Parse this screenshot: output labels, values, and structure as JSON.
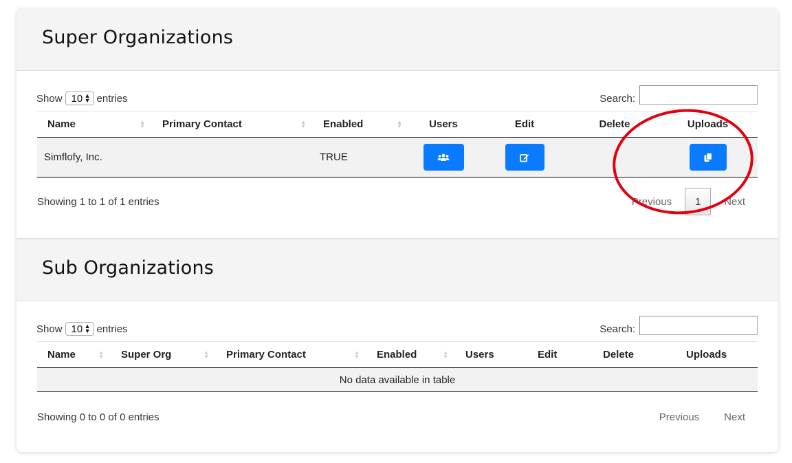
{
  "super_orgs": {
    "title": "Super Organizations",
    "length": {
      "show_label": "Show",
      "value": "10",
      "entries_label": "entries"
    },
    "search": {
      "label": "Search:",
      "value": ""
    },
    "columns": [
      "Name",
      "Primary Contact",
      "Enabled",
      "Users",
      "Edit",
      "Delete",
      "Uploads"
    ],
    "rows": [
      {
        "name": "Simflofy, Inc.",
        "primary_contact": "",
        "enabled": "TRUE",
        "users_icon": "users-icon",
        "edit_icon": "edit-icon",
        "uploads_icon": "copy-files-icon"
      }
    ],
    "info": "Showing 1 to 1 of 1 entries",
    "pagination": {
      "previous": "Previous",
      "current_page": "1",
      "next": "Next"
    }
  },
  "sub_orgs": {
    "title": "Sub Organizations",
    "length": {
      "show_label": "Show",
      "value": "10",
      "entries_label": "entries"
    },
    "search": {
      "label": "Search:",
      "value": ""
    },
    "columns": [
      "Name",
      "Super Org",
      "Primary Contact",
      "Enabled",
      "Users",
      "Edit",
      "Delete",
      "Uploads"
    ],
    "empty_message": "No data available in table",
    "info": "Showing 0 to 0 of 0 entries",
    "pagination": {
      "previous": "Previous",
      "next": "Next"
    }
  },
  "colors": {
    "primary_button": "#0a7bff",
    "annotation": "#e3000f",
    "header_bg": "#f4f4f4"
  }
}
